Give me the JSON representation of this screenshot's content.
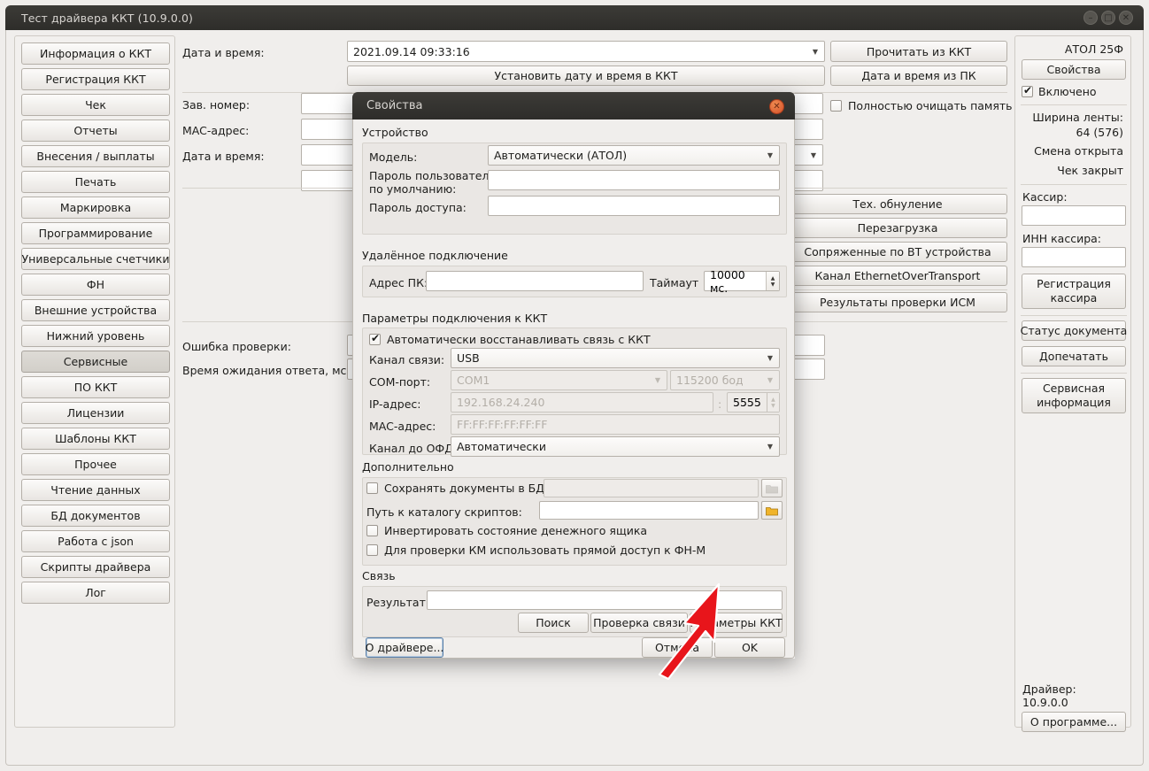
{
  "window": {
    "title": "Тест драйвера ККТ (10.9.0.0)",
    "buttons": {
      "minimize": "–",
      "maximize": "□",
      "close": "✕"
    }
  },
  "sidebar": {
    "items": [
      {
        "label": "Информация о ККТ",
        "active": false
      },
      {
        "label": "Регистрация ККТ",
        "active": false
      },
      {
        "label": "Чек",
        "active": false
      },
      {
        "label": "Отчеты",
        "active": false
      },
      {
        "label": "Внесения / выплаты",
        "active": false
      },
      {
        "label": "Печать",
        "active": false
      },
      {
        "label": "Маркировка",
        "active": false
      },
      {
        "label": "Программирование",
        "active": false
      },
      {
        "label": "Универсальные счетчики",
        "active": false
      },
      {
        "label": "ФН",
        "active": false
      },
      {
        "label": "Внешние устройства",
        "active": false
      },
      {
        "label": "Нижний уровень",
        "active": false
      },
      {
        "label": "Сервисные",
        "active": true
      },
      {
        "label": "ПО ККТ",
        "active": false
      },
      {
        "label": "Лицензии",
        "active": false
      },
      {
        "label": "Шаблоны ККТ",
        "active": false
      },
      {
        "label": "Прочее",
        "active": false
      },
      {
        "label": "Чтение данных",
        "active": false
      },
      {
        "label": "БД документов",
        "active": false
      },
      {
        "label": "Работа с json",
        "active": false
      },
      {
        "label": "Скрипты драйвера",
        "active": false
      },
      {
        "label": "Лог",
        "active": false
      }
    ]
  },
  "main": {
    "labels": {
      "datetime": "Дата и время:",
      "serial": "Зав. номер:",
      "mac": "MAC-адрес:",
      "datetime2": "Дата и время:",
      "check_error": "Ошибка проверки:",
      "wait_time": "Время ожидания ответа, мс:"
    },
    "datetime_value": "2021.09.14 09:33:16",
    "buttons": {
      "read_from_kkt": "Прочитать из ККТ",
      "set_datetime": "Установить дату и время в ККТ",
      "datetime_from_pc": "Дата и время из ПК",
      "tech_reset": "Тех. обнуление",
      "reboot": "Перезагрузка",
      "bt_devices": "Сопряженные по BT устройства",
      "eot_channel": "Канал EthernetOverTransport",
      "ism_results": "Результаты проверки ИСМ"
    },
    "checkbox_clear_memory": "Полностью очищать память"
  },
  "right_panel": {
    "device_name": "АТОЛ 25Ф",
    "properties_button": "Свойства",
    "enabled_checkbox": "Включено",
    "tape_width_label": "Ширина ленты:",
    "tape_width_value": "64 (576)",
    "shift_status": "Смена открыта",
    "receipt_status": "Чек закрыт",
    "cashier_label": "Кассир:",
    "cashier_value": "",
    "cashier_inn_label": "ИНН кассира:",
    "cashier_inn_value": "",
    "register_cashier_button": "Регистрация кассира",
    "doc_status_button": "Статус документа",
    "reprint_button": "Допечатать",
    "service_info_button": "Сервисная информация",
    "driver_label": "Драйвер:",
    "driver_version": "10.9.0.0",
    "about_button": "О программе..."
  },
  "dialog": {
    "title": "Свойства",
    "close_glyph": "✕",
    "device_group": {
      "title": "Устройство",
      "model_label": "Модель:",
      "model_value": "Автоматически (АТОЛ)",
      "user_password_label": "Пароль пользователя\nпо умолчанию:",
      "user_password_label_1": "Пароль пользователя",
      "user_password_label_2": "по умолчанию:",
      "user_password_value": "",
      "access_password_label": "Пароль доступа:",
      "access_password_value": ""
    },
    "remote_group": {
      "title": "Удалённое подключение",
      "pc_address_label": "Адрес ПК:",
      "pc_address_value": "",
      "timeout_label": "Таймаут",
      "timeout_value": "10000 мс."
    },
    "connection_group": {
      "title": "Параметры подключения к ККТ",
      "auto_restore_label": "Автоматически восстанавливать связь с ККТ",
      "auto_restore_checked": true,
      "channel_label": "Канал связи:",
      "channel_value": "USB",
      "com_port_label": "COM-порт:",
      "com_port_placeholder": "COM1",
      "baud_placeholder": "115200 бод",
      "ip_label": "IP-адрес:",
      "ip_placeholder": "192.168.24.240",
      "port_separator": ":",
      "port_placeholder": "5555",
      "mac_label": "MAC-адрес:",
      "mac_placeholder": "FF:FF:FF:FF:FF:FF",
      "ofd_label": "Канал до ОФД:",
      "ofd_value": "Автоматически"
    },
    "additional_group": {
      "title": "Дополнительно",
      "save_docs_label": "Сохранять документы в БД",
      "save_docs_checked": false,
      "save_docs_path": "",
      "scripts_path_label": "Путь к каталогу скриптов:",
      "scripts_path_value": "",
      "invert_drawer_label": "Инвертировать состояние денежного ящика",
      "invert_drawer_checked": false,
      "direct_fnm_label": "Для проверки КМ использовать прямой доступ к ФН-М",
      "direct_fnm_checked": false
    },
    "link_group": {
      "title": "Связь",
      "result_label": "Результат:",
      "result_value": "",
      "search_button": "Поиск",
      "check_link_button": "Проверка связи",
      "kkt_params_button": "Параметры ККТ"
    },
    "footer": {
      "about_driver_button": "О драйвере...",
      "cancel_button": "Отмена",
      "ok_button": "OK"
    }
  },
  "annotation": {
    "arrow_color": "#e8151b"
  }
}
